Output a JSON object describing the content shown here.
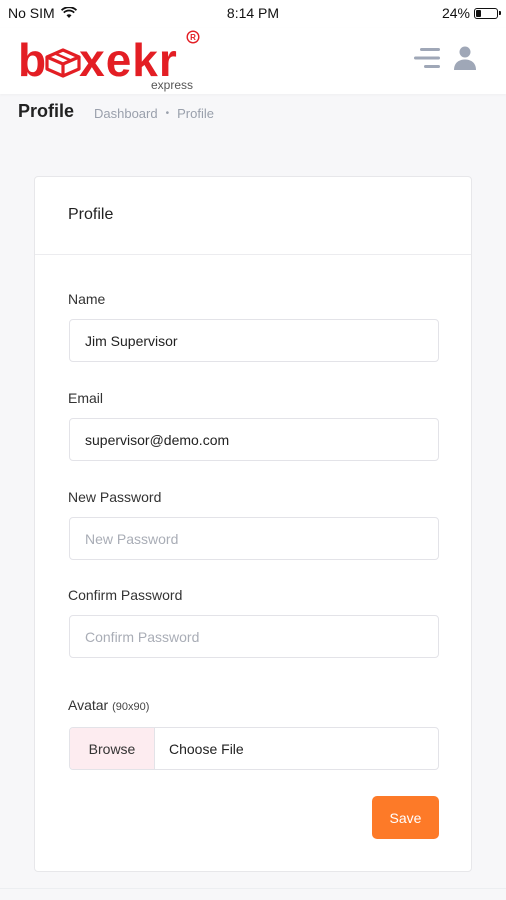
{
  "status_bar": {
    "carrier": "No SIM",
    "time": "8:14 PM",
    "battery_percent": "24%",
    "battery_level": 0.24
  },
  "header": {
    "logo_text": "b xekr",
    "logo_subtext": "express",
    "brand_color": "#e31e24",
    "menu_icon": "menu-icon",
    "user_icon": "user-icon"
  },
  "page": {
    "title": "Profile",
    "breadcrumb": [
      "Dashboard",
      "Profile"
    ]
  },
  "card": {
    "title": "Profile",
    "fields": {
      "name": {
        "label": "Name",
        "value": "Jim Supervisor"
      },
      "email": {
        "label": "Email",
        "value": "supervisor@demo.com"
      },
      "new_password": {
        "label": "New Password",
        "placeholder": "New Password"
      },
      "confirm_password": {
        "label": "Confirm Password",
        "placeholder": "Confirm Password"
      },
      "avatar": {
        "label": "Avatar",
        "hint": "(90x90)",
        "browse": "Browse",
        "choose": "Choose File"
      }
    },
    "save_label": "Save",
    "accent_color": "#fd7a28"
  }
}
